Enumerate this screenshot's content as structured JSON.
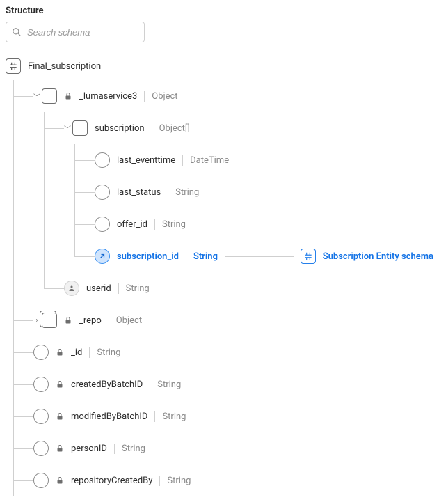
{
  "panel": {
    "title": "Structure"
  },
  "search": {
    "placeholder": "Search schema"
  },
  "root": {
    "name": "Final_subscription"
  },
  "lumaservice": {
    "name": "_lumaservice3",
    "type": "Object",
    "locked": true,
    "subscription": {
      "name": "subscription",
      "type": "Object[]",
      "fields": {
        "last_eventtime": {
          "name": "last_eventtime",
          "type": "DateTime"
        },
        "last_status": {
          "name": "last_status",
          "type": "String"
        },
        "offer_id": {
          "name": "offer_id",
          "type": "String"
        },
        "subscription_id": {
          "name": "subscription_id",
          "type": "String"
        }
      }
    },
    "userid": {
      "name": "userid",
      "type": "String"
    }
  },
  "repo": {
    "name": "_repo",
    "type": "Object",
    "locked": true
  },
  "fields": {
    "_id": {
      "name": "_id",
      "type": "String",
      "locked": true
    },
    "createdByBatchID": {
      "name": "createdByBatchID",
      "type": "String",
      "locked": true
    },
    "modifiedByBatchID": {
      "name": "modifiedByBatchID",
      "type": "String",
      "locked": true
    },
    "personID": {
      "name": "personID",
      "type": "String",
      "locked": true
    },
    "repositoryCreatedBy": {
      "name": "repositoryCreatedBy",
      "type": "String",
      "locked": true
    }
  },
  "relationship": {
    "target_label": "Subscription Entity schema"
  }
}
